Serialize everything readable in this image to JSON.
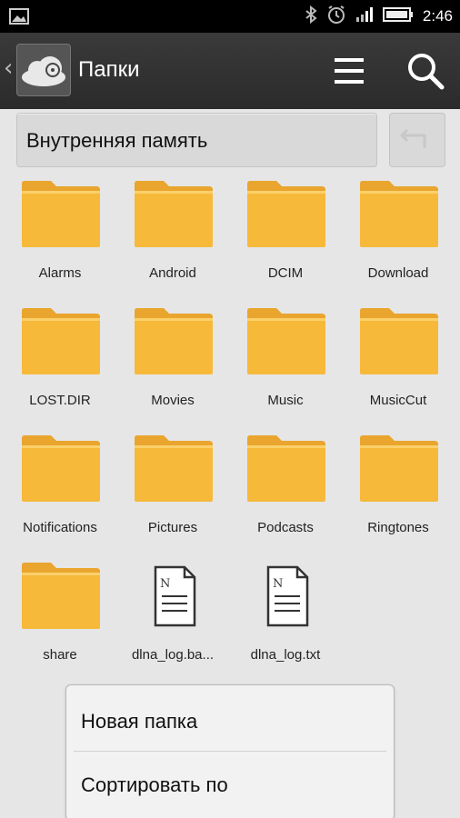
{
  "status_bar": {
    "time": "2:46",
    "icons": [
      "image-icon",
      "bluetooth-icon",
      "alarm-icon",
      "signal-icon",
      "battery-icon"
    ]
  },
  "action_bar": {
    "title": "Папки",
    "app_icon": "cloud-icon",
    "menu_icon": "menu-icon",
    "search_icon": "search-icon"
  },
  "location": {
    "label": "Внутренняя память",
    "up_icon": "up-arrow-icon"
  },
  "colors": {
    "folder": "#f6b93a",
    "folder_tab": "#e9a52d",
    "action_bar": "#2f2f2f",
    "background": "#e6e6e6"
  },
  "items": [
    {
      "label": "Alarms",
      "type": "folder"
    },
    {
      "label": "Android",
      "type": "folder"
    },
    {
      "label": "DCIM",
      "type": "folder"
    },
    {
      "label": "Download",
      "type": "folder"
    },
    {
      "label": "LOST.DIR",
      "type": "folder"
    },
    {
      "label": "Movies",
      "type": "folder"
    },
    {
      "label": "Music",
      "type": "folder"
    },
    {
      "label": "MusicCut",
      "type": "folder"
    },
    {
      "label": "Notifications",
      "type": "folder"
    },
    {
      "label": "Pictures",
      "type": "folder"
    },
    {
      "label": "Podcasts",
      "type": "folder"
    },
    {
      "label": "Ringtones",
      "type": "folder"
    },
    {
      "label": "share",
      "type": "folder"
    },
    {
      "label": "dlna_log.ba...",
      "type": "file"
    },
    {
      "label": "dlna_log.txt",
      "type": "file"
    }
  ],
  "context_menu": {
    "items": [
      {
        "label": "Новая папка"
      },
      {
        "label": "Сортировать по"
      }
    ]
  }
}
